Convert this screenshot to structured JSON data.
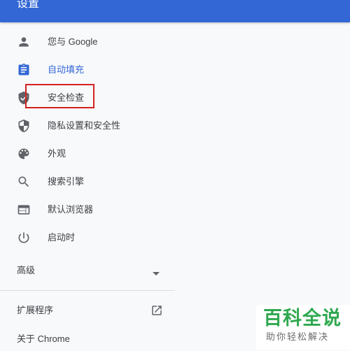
{
  "header": {
    "title": "设置"
  },
  "nav": {
    "items": [
      {
        "label": "您与 Google",
        "icon": "person-icon"
      },
      {
        "label": "自动填充",
        "icon": "clipboard-icon",
        "active": true
      },
      {
        "label": "安全检查",
        "icon": "shield-check-icon"
      },
      {
        "label": "隐私设置和安全性",
        "icon": "privacy-shield-icon"
      },
      {
        "label": "外观",
        "icon": "palette-icon"
      },
      {
        "label": "搜索引擎",
        "icon": "search-icon"
      },
      {
        "label": "默认浏览器",
        "icon": "browser-window-icon"
      },
      {
        "label": "启动时",
        "icon": "power-icon"
      }
    ],
    "advanced": {
      "label": "高级"
    },
    "extensions": {
      "label": "扩展程序"
    },
    "about": {
      "label": "关于 Chrome"
    }
  },
  "watermark": {
    "main": "百科全说",
    "sub": "助你轻松解决"
  },
  "colors": {
    "accent": "#3367d6",
    "highlight": "#d32121",
    "watermark": "#2fa84f"
  }
}
